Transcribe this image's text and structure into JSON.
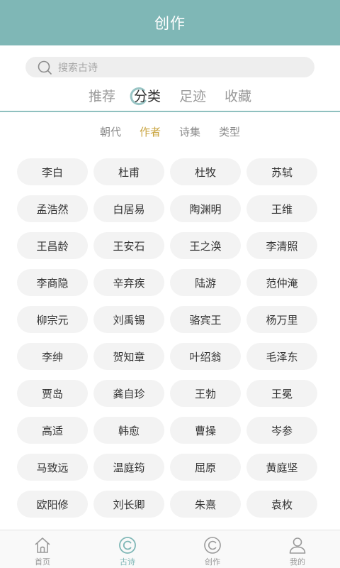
{
  "header": {
    "title": "创作"
  },
  "search": {
    "placeholder": "搜索古诗",
    "icon": "search-icon"
  },
  "tabs": [
    {
      "label": "推荐",
      "active": false
    },
    {
      "label": "分类",
      "active": true
    },
    {
      "label": "足迹",
      "active": false
    },
    {
      "label": "收藏",
      "active": false
    }
  ],
  "subtabs": [
    {
      "label": "朝代",
      "active": false
    },
    {
      "label": "作者",
      "active": true
    },
    {
      "label": "诗集",
      "active": false
    },
    {
      "label": "类型",
      "active": false
    }
  ],
  "authors": [
    "李白",
    "杜甫",
    "杜牧",
    "苏轼",
    "孟浩然",
    "白居易",
    "陶渊明",
    "王维",
    "王昌龄",
    "王安石",
    "王之涣",
    "李清照",
    "李商隐",
    "辛弃疾",
    "陆游",
    "范仲淹",
    "柳宗元",
    "刘禹锡",
    "骆宾王",
    "杨万里",
    "李绅",
    "贺知章",
    "叶绍翁",
    "毛泽东",
    "贾岛",
    "龚自珍",
    "王勃",
    "王冕",
    "高适",
    "韩愈",
    "曹操",
    "岑参",
    "马致远",
    "温庭筠",
    "屈原",
    "黄庭坚",
    "欧阳修",
    "刘长卿",
    "朱熹",
    "袁枚"
  ],
  "bottom_nav": [
    {
      "label": "首页",
      "icon": "home-icon",
      "active": false
    },
    {
      "label": "古诗",
      "icon": "poem-icon",
      "active": true
    },
    {
      "label": "创作",
      "icon": "create-icon",
      "active": false
    },
    {
      "label": "我的",
      "icon": "profile-icon",
      "active": false
    }
  ],
  "colors": {
    "accent": "#7fb7b6",
    "highlight": "#c9a440",
    "chip_bg": "#f3f3f3"
  }
}
